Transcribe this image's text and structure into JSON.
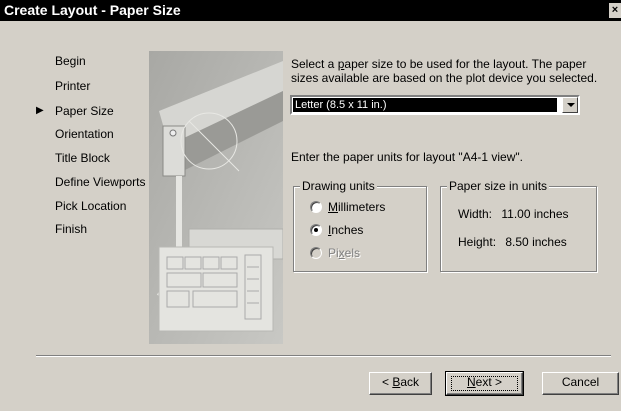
{
  "window": {
    "title": "Create Layout - Paper Size",
    "close_glyph": "×"
  },
  "nav": {
    "items": [
      {
        "label": "Begin"
      },
      {
        "label": "Printer"
      },
      {
        "label": "Paper Size",
        "current": true
      },
      {
        "label": "Orientation"
      },
      {
        "label": "Title Block"
      },
      {
        "label": "Define Viewports"
      },
      {
        "label": "Pick Location"
      },
      {
        "label": "Finish"
      }
    ],
    "current_marker": "▶"
  },
  "content": {
    "intro_a": "Select a ",
    "intro_mn": "p",
    "intro_b": "aper size to be used for the layout.  The paper sizes available are based on the plot device you selected.",
    "paper_size_selected": "Letter (8.5 x 11 in.)",
    "units_prompt": "Enter the paper units for layout \"A4-1 view\"."
  },
  "drawing_units": {
    "legend": "Drawing units",
    "options": [
      {
        "mn": "M",
        "rest": "illimeters",
        "checked": false,
        "disabled": false
      },
      {
        "mn": "I",
        "rest": "nches",
        "checked": true,
        "disabled": false
      },
      {
        "pre": "Pi",
        "mn": "x",
        "rest": "els",
        "checked": false,
        "disabled": true
      }
    ]
  },
  "paper_units": {
    "legend": "Paper size in units",
    "width_label": "Width:",
    "width_value": "11.00 inches",
    "height_label": "Height:",
    "height_value": "8.50 inches"
  },
  "buttons": {
    "back_pre": "< ",
    "back_mn": "B",
    "back_rest": "ack",
    "next_mn": "N",
    "next_rest": "ext >",
    "cancel": "Cancel"
  },
  "colors": {
    "title_bar": "#000000",
    "dialog_face": "#d4d0c8",
    "highlight": "#000000"
  }
}
